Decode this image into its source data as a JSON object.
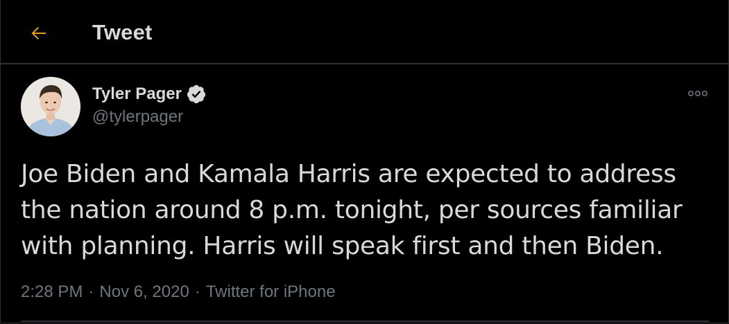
{
  "header": {
    "title": "Tweet",
    "back_icon": "arrow-left-icon",
    "accent_color": "#f5a623"
  },
  "tweet": {
    "author": {
      "display_name": "Tyler Pager",
      "handle": "@tylerpager",
      "verified_icon": "verified-badge-icon",
      "avatar": "avatar-photo"
    },
    "more_icon": "more-options-icon",
    "text": "Joe Biden and Kamala Harris are expected to address the nation around 8 p.m. tonight, per sources familiar with planning. Harris will speak first and then Biden.",
    "time": "2:28 PM",
    "separator": "·",
    "date": "Nov 6, 2020",
    "source": "Twitter for iPhone"
  },
  "colors": {
    "background": "#000000",
    "text": "#d9d9d9",
    "muted": "#6e767d",
    "divider": "#2f3336"
  }
}
